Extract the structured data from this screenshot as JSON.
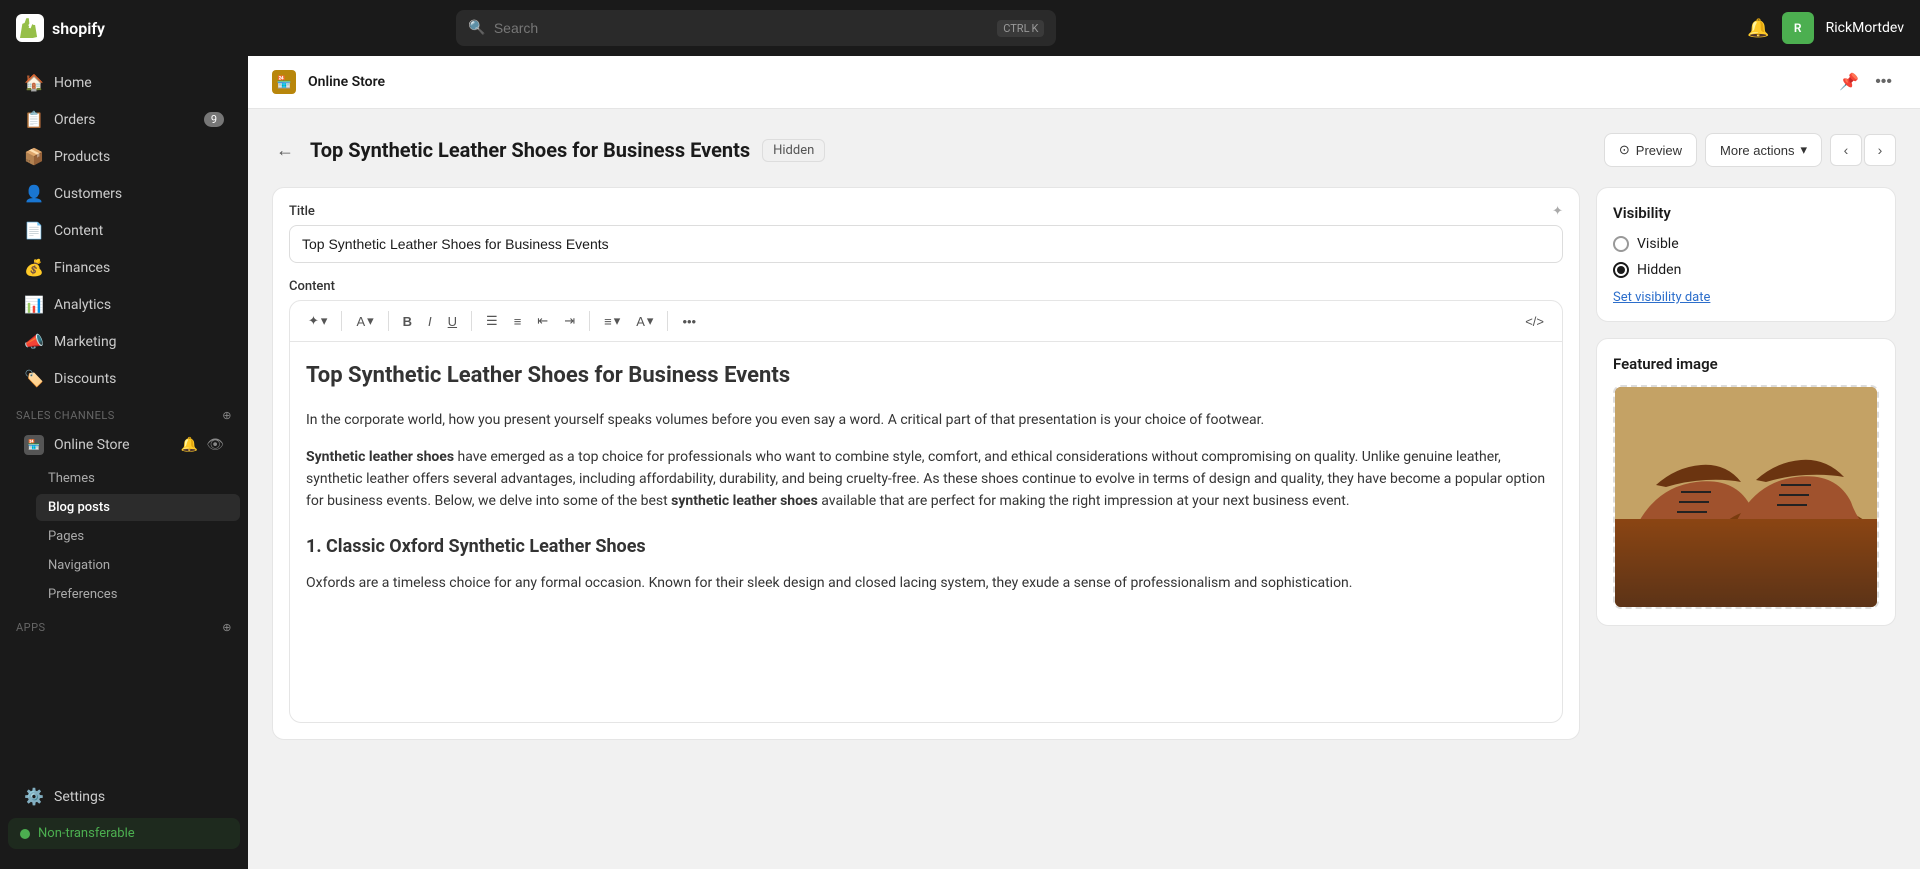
{
  "topnav": {
    "logo_text": "shopify",
    "search_placeholder": "Search",
    "shortcut_ctrl": "CTRL",
    "shortcut_key": "K",
    "username": "RickMortdev"
  },
  "sidebar": {
    "items": [
      {
        "id": "home",
        "label": "Home",
        "icon": "🏠"
      },
      {
        "id": "orders",
        "label": "Orders",
        "icon": "📋",
        "badge": "9"
      },
      {
        "id": "products",
        "label": "Products",
        "icon": "📦"
      },
      {
        "id": "customers",
        "label": "Customers",
        "icon": "👤"
      },
      {
        "id": "content",
        "label": "Content",
        "icon": "📄"
      },
      {
        "id": "finances",
        "label": "Finances",
        "icon": "💰"
      },
      {
        "id": "analytics",
        "label": "Analytics",
        "icon": "📊"
      },
      {
        "id": "marketing",
        "label": "Marketing",
        "icon": "📣"
      },
      {
        "id": "discounts",
        "label": "Discounts",
        "icon": "🏷️"
      }
    ],
    "sales_channels_label": "Sales channels",
    "online_store_label": "Online Store",
    "sub_items": [
      {
        "id": "themes",
        "label": "Themes"
      },
      {
        "id": "blog_posts",
        "label": "Blog posts",
        "active": true
      },
      {
        "id": "pages",
        "label": "Pages"
      },
      {
        "id": "navigation",
        "label": "Navigation"
      },
      {
        "id": "preferences",
        "label": "Preferences"
      }
    ],
    "apps_label": "Apps",
    "settings_label": "Settings",
    "non_transferable_label": "Non-transferable"
  },
  "secondary_nav": {
    "store_name": "Online Store"
  },
  "page": {
    "back_label": "←",
    "title": "Top Synthetic Leather Shoes for Business Events",
    "status_badge": "Hidden",
    "preview_label": "Preview",
    "more_actions_label": "More actions"
  },
  "editor": {
    "title_label": "Title",
    "title_value": "Top Synthetic Leather Shoes for Business Events",
    "content_label": "Content",
    "content_h1": "Top Synthetic Leather Shoes for Business Events",
    "content_p1": "In the corporate world, how you present yourself speaks volumes before you even say a word. A critical part of that presentation is your choice of footwear.",
    "content_p2_before": "",
    "content_bold": "Synthetic leather shoes",
    "content_p2_after": " have emerged as a top choice for professionals who want to combine style, comfort, and ethical considerations without compromising on quality. Unlike genuine leather, synthetic leather offers several advantages, including affordability, durability, and being cruelty-free. As these shoes continue to evolve in terms of design and quality, they have become a popular option for business events. Below, we delve into some of the best ",
    "content_bold2": "synthetic leather shoes",
    "content_p2_end": " available that are perfect for making the right impression at your next business event.",
    "content_h2": "1. Classic Oxford Synthetic Leather Shoes",
    "content_p3": "Oxfords are a timeless choice for any formal occasion. Known for their sleek design and closed lacing system, they exude a sense of professionalism and sophistication."
  },
  "visibility": {
    "title": "Visibility",
    "visible_label": "Visible",
    "hidden_label": "Hidden",
    "set_date_label": "Set visibility date",
    "selected": "hidden"
  },
  "featured_image": {
    "title": "Featured image"
  },
  "toolbar": {
    "items": [
      "✦",
      "A",
      "B",
      "I",
      "U",
      "≡",
      "⊞",
      "⊟",
      "⊠",
      "≡",
      "A",
      "•••",
      "</>"
    ]
  }
}
